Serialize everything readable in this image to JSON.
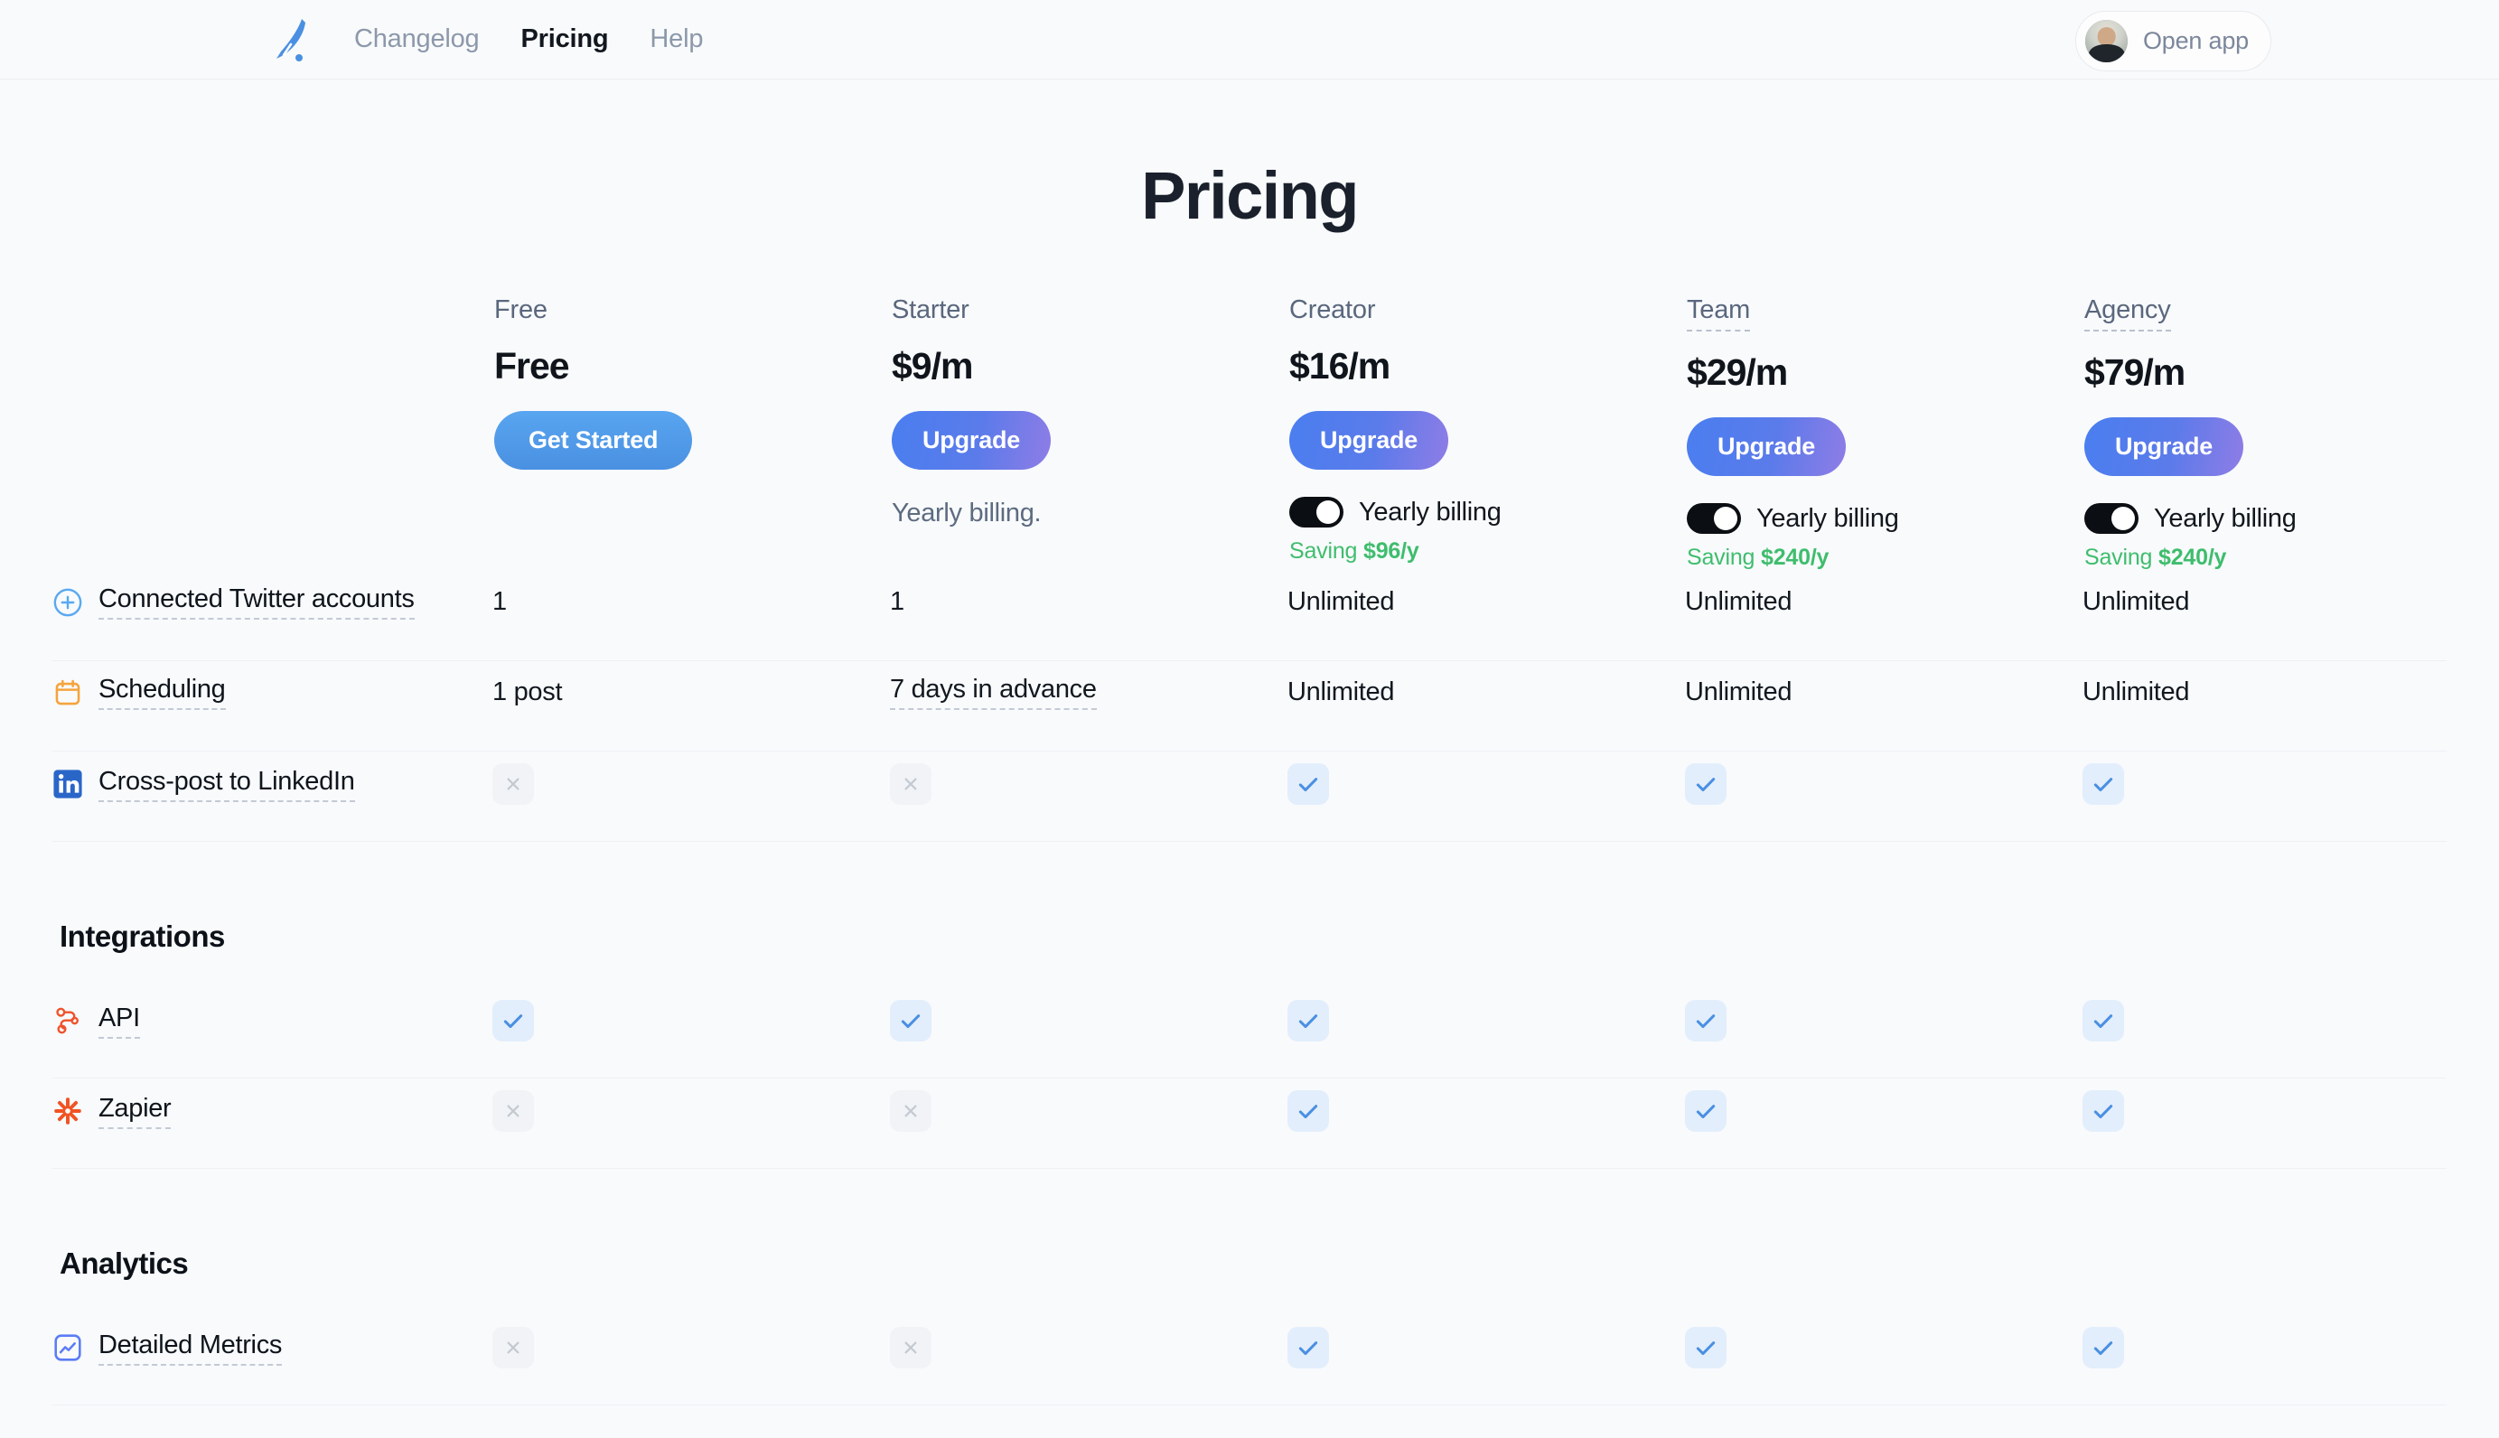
{
  "nav": {
    "logo_icon": "feather-logo-icon",
    "links": [
      {
        "label": "Changelog",
        "active": false
      },
      {
        "label": "Pricing",
        "active": true
      },
      {
        "label": "Help",
        "active": false
      }
    ],
    "open_app_label": "Open app"
  },
  "page": {
    "title": "Pricing"
  },
  "colors": {
    "accent_blue": "#4a90e2",
    "gradient_from": "#4a7ef0",
    "gradient_to": "#8f7ce6",
    "saving_green": "#3fbd6d",
    "toggle_on": "#0b0e12",
    "check_blue": "#4a90e2",
    "background": "#f8fafc"
  },
  "plans": [
    {
      "name": "Free",
      "name_hinted": false,
      "price": "Free",
      "cta_label": "Get Started",
      "cta_style": "solid",
      "billing_note": null,
      "toggle": null,
      "saving_prefix": null,
      "saving_amount": null
    },
    {
      "name": "Starter",
      "name_hinted": false,
      "price": "$9/m",
      "cta_label": "Upgrade",
      "cta_style": "gradient",
      "billing_note": "Yearly billing.",
      "toggle": null,
      "saving_prefix": null,
      "saving_amount": null
    },
    {
      "name": "Creator",
      "name_hinted": false,
      "price": "$16/m",
      "cta_label": "Upgrade",
      "cta_style": "gradient",
      "billing_note": null,
      "toggle": {
        "label": "Yearly billing",
        "state": "on"
      },
      "saving_prefix": "Saving ",
      "saving_amount": "$96/y"
    },
    {
      "name": "Team",
      "name_hinted": true,
      "price": "$29/m",
      "cta_label": "Upgrade",
      "cta_style": "gradient",
      "billing_note": null,
      "toggle": {
        "label": "Yearly billing",
        "state": "on"
      },
      "saving_prefix": "Saving ",
      "saving_amount": "$240/y"
    },
    {
      "name": "Agency",
      "name_hinted": true,
      "price": "$79/m",
      "cta_label": "Upgrade",
      "cta_style": "gradient",
      "billing_note": null,
      "toggle": {
        "label": "Yearly billing",
        "state": "on"
      },
      "saving_prefix": "Saving ",
      "saving_amount": "$240/y"
    }
  ],
  "sections": [
    {
      "heading": null,
      "features": [
        {
          "label": "Connected Twitter accounts",
          "icon": "plus-circle-icon",
          "values": [
            {
              "type": "text",
              "text": "1"
            },
            {
              "type": "text",
              "text": "1"
            },
            {
              "type": "text",
              "text": "Unlimited"
            },
            {
              "type": "text",
              "text": "Unlimited"
            },
            {
              "type": "text",
              "text": "Unlimited"
            }
          ]
        },
        {
          "label": "Scheduling",
          "icon": "calendar-icon",
          "values": [
            {
              "type": "text",
              "text": "1 post"
            },
            {
              "type": "text",
              "text": "7 days in advance",
              "hinted": true
            },
            {
              "type": "text",
              "text": "Unlimited"
            },
            {
              "type": "text",
              "text": "Unlimited"
            },
            {
              "type": "text",
              "text": "Unlimited"
            }
          ]
        },
        {
          "label": "Cross-post to LinkedIn",
          "icon": "linkedin-icon",
          "values": [
            {
              "type": "no"
            },
            {
              "type": "no"
            },
            {
              "type": "yes"
            },
            {
              "type": "yes"
            },
            {
              "type": "yes"
            }
          ]
        }
      ]
    },
    {
      "heading": "Integrations",
      "features": [
        {
          "label": "API",
          "icon": "api-nodes-icon",
          "values": [
            {
              "type": "yes"
            },
            {
              "type": "yes"
            },
            {
              "type": "yes"
            },
            {
              "type": "yes"
            },
            {
              "type": "yes"
            }
          ]
        },
        {
          "label": "Zapier",
          "icon": "zapier-icon",
          "values": [
            {
              "type": "no"
            },
            {
              "type": "no"
            },
            {
              "type": "yes"
            },
            {
              "type": "yes"
            },
            {
              "type": "yes"
            }
          ]
        }
      ]
    },
    {
      "heading": "Analytics",
      "features": [
        {
          "label": "Detailed Metrics",
          "icon": "chart-square-icon",
          "values": [
            {
              "type": "no"
            },
            {
              "type": "no"
            },
            {
              "type": "yes"
            },
            {
              "type": "yes"
            },
            {
              "type": "yes"
            }
          ]
        }
      ]
    }
  ]
}
